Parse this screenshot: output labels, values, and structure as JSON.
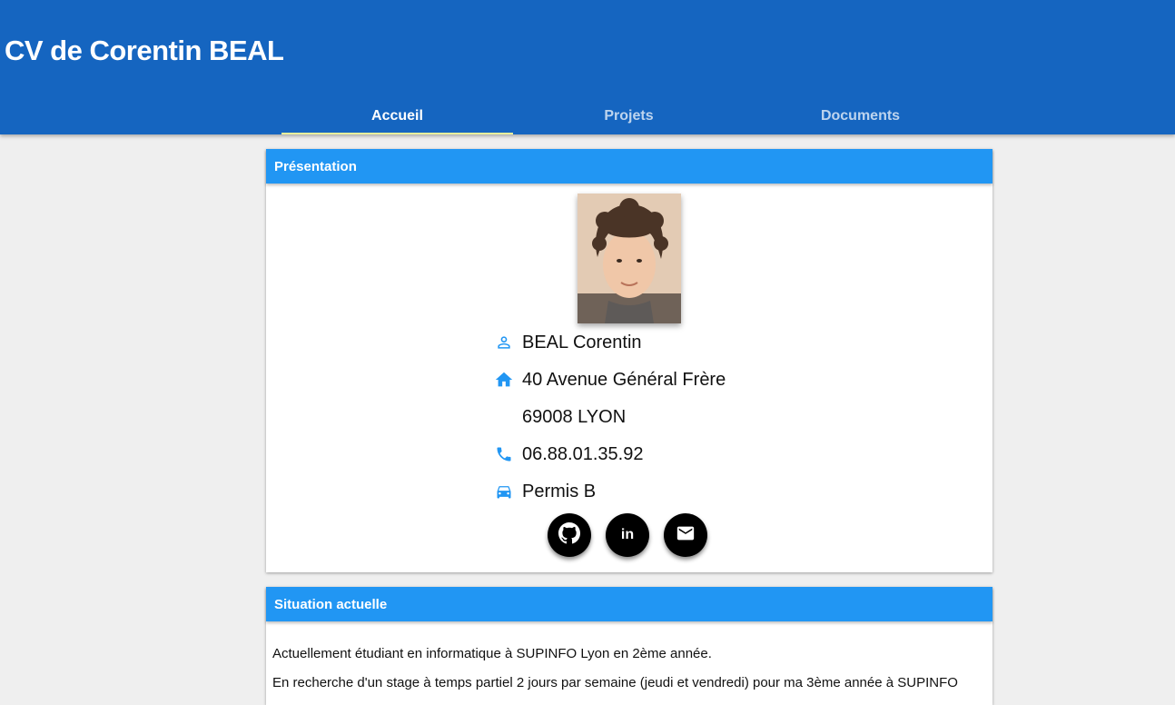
{
  "header": {
    "title": "CV de Corentin BEAL",
    "tabs": [
      {
        "label": "Accueil",
        "active": true
      },
      {
        "label": "Projets",
        "active": false
      },
      {
        "label": "Documents",
        "active": false
      }
    ]
  },
  "presentation": {
    "title": "Présentation",
    "name": "BEAL Corentin",
    "address_line1": "40 Avenue Général Frère",
    "address_line2": "69008 LYON",
    "phone": "06.88.01.35.92",
    "license": "Permis B",
    "icons": {
      "name": "person-icon",
      "address": "home-icon",
      "phone": "phone-icon",
      "license": "car-icon"
    },
    "socials": [
      {
        "icon": "github-icon"
      },
      {
        "icon": "linkedin-icon",
        "label": "in"
      },
      {
        "icon": "mail-icon"
      }
    ]
  },
  "situation": {
    "title": "Situation actuelle",
    "paragraph1": "Actuellement étudiant en informatique à SUPINFO Lyon en 2ème année.",
    "paragraph2": "En recherche d'un stage à temps partiel 2 jours par semaine (jeudi et vendredi) pour ma 3ème année à SUPINFO"
  },
  "colors": {
    "appbar": "#1565c0",
    "card_header": "#2196f3",
    "icon_accent": "#2196f3",
    "tab_indicator": "#e6ee9c"
  }
}
